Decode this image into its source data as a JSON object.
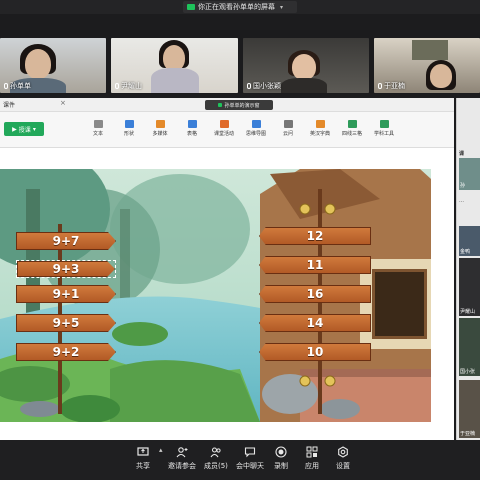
{
  "share_banner": {
    "text": "你正在观看孙单单的屏幕"
  },
  "participants": [
    {
      "name": "孙单单"
    },
    {
      "name": "尹耀山"
    },
    {
      "name": "国小张颖"
    },
    {
      "name": "于亚楠"
    }
  ],
  "document": {
    "title": "课件",
    "share_status": "孙单单的演示窗"
  },
  "ribbon": {
    "start_label": "授课",
    "tools": [
      "文本",
      "形状",
      "多媒体",
      "表格",
      "课堂活动",
      "思维导图",
      "云问",
      "英汉字典",
      "四线三格",
      "学科工具"
    ]
  },
  "slide": {
    "left_signs": [
      "9+7",
      "9+3",
      "9+1",
      "9+5",
      "9+2"
    ],
    "right_signs": [
      "12",
      "11",
      "16",
      "14",
      "10"
    ]
  },
  "right_panel": {
    "header": "课",
    "names": [
      "孙",
      "尹耀山",
      "国小张",
      "于亚楠"
    ],
    "tag": "金鸭"
  },
  "toolbar": {
    "items": [
      "共享",
      "邀请参会",
      "成员(5)",
      "会中聊天",
      "录制",
      "应用",
      "设置"
    ]
  },
  "colors": {
    "accent_green": "#22a85a",
    "sign_orange": "#c66a30",
    "toolbar_bg": "#1f1f21"
  }
}
